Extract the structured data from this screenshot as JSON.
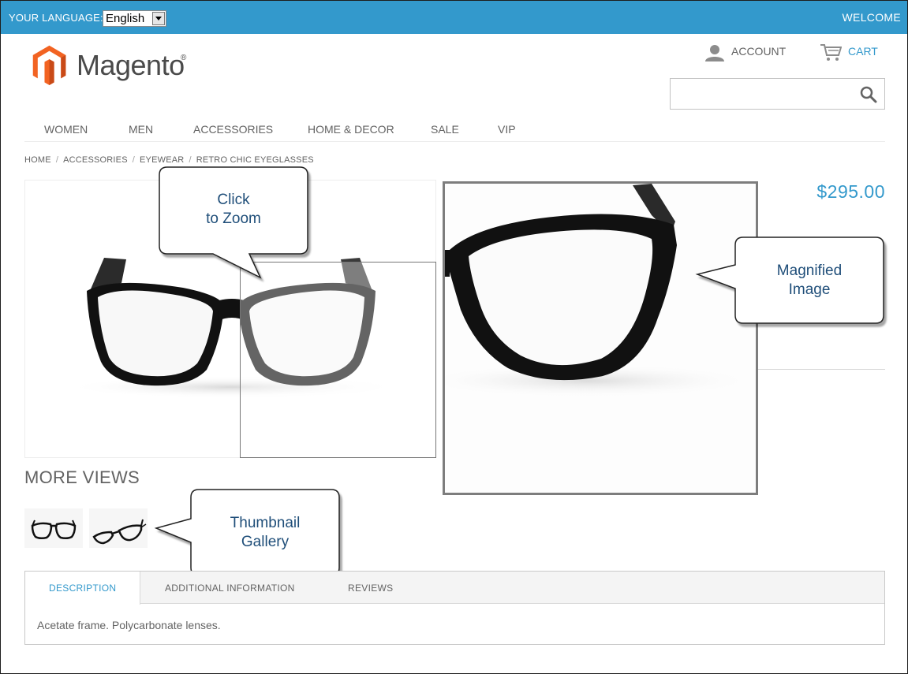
{
  "topbar": {
    "language_label": "YOUR LANGUAGE:",
    "language_value": "English",
    "welcome": "WELCOME"
  },
  "header": {
    "logo_text": "Magento",
    "logo_mark": "®",
    "account_label": "ACCOUNT",
    "cart_label": "CART",
    "search_value": "",
    "icons": {
      "account": "person-icon",
      "cart": "cart-icon",
      "search": "magnifier-icon"
    }
  },
  "nav": {
    "items": [
      {
        "label": "WOMEN"
      },
      {
        "label": "MEN"
      },
      {
        "label": "ACCESSORIES"
      },
      {
        "label": "HOME & DECOR"
      },
      {
        "label": "SALE"
      },
      {
        "label": "VIP"
      }
    ]
  },
  "breadcrumb": {
    "items": [
      "HOME",
      "ACCESSORIES",
      "EYEWEAR",
      "RETRO CHIC EYEGLASSES"
    ],
    "separator": "/"
  },
  "product": {
    "price": "$295.00",
    "more_views_label": "MORE VIEWS"
  },
  "callouts": {
    "zoom": [
      "Click",
      "to Zoom"
    ],
    "magnified": [
      "Magnified",
      "Image"
    ],
    "thumbnails": [
      "Thumbnail",
      "Gallery"
    ]
  },
  "tabs": {
    "items": [
      {
        "label": "DESCRIPTION"
      },
      {
        "label": "ADDITIONAL INFORMATION"
      },
      {
        "label": "REVIEWS"
      }
    ],
    "content": "Acetate frame. Polycarbonate lenses."
  },
  "colors": {
    "accent": "#3399cc",
    "callout_text": "#1f4e79",
    "text": "#636363",
    "logo_orange": "#f26322"
  }
}
